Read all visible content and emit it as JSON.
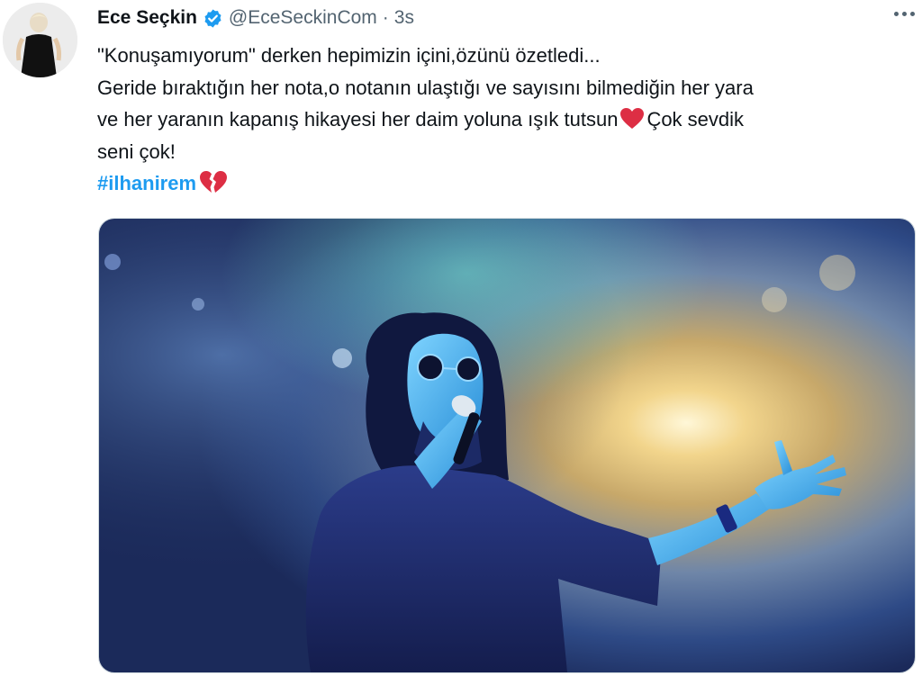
{
  "tweet": {
    "author_name": "Ece Seçkin",
    "author_handle": "@EceSeckinCom",
    "separator": "·",
    "timestamp": "3s",
    "verified_icon": "verified-badge-icon",
    "more_icon": "more-options-icon",
    "text_lines": [
      "\"Konuşamıyorum\" derken hepimizin içini,özünü özetledi...",
      "Geride bıraktığın her nota,o notanın ulaştığı ve sayısını bilmediğin her yara",
      "ve her yaranın kapanış hikayesi her daim yoluna ışık tutsun",
      "Çok sevdik",
      "seni çok!"
    ],
    "heart_emoji": "red-heart-icon",
    "hashtag": "#ilhanirem",
    "broken_heart_emoji": "broken-heart-icon",
    "accent_color": "#1d9bf0"
  },
  "media": {
    "kind": "photo",
    "subject": "concert-singer-photo"
  }
}
